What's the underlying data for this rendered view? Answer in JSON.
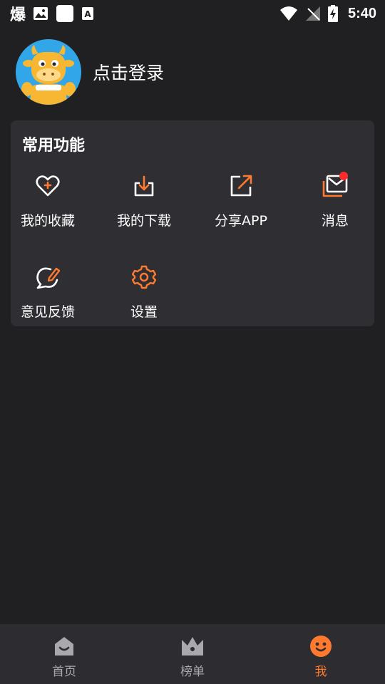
{
  "status_bar": {
    "app_text": "爆",
    "time": "5:40"
  },
  "profile": {
    "login_text": "点击登录"
  },
  "common_functions": {
    "title": "常用功能",
    "items": [
      {
        "label": "我的收藏",
        "icon": "heart-plus-icon"
      },
      {
        "label": "我的下载",
        "icon": "download-icon"
      },
      {
        "label": "分享APP",
        "icon": "share-icon"
      },
      {
        "label": "消息",
        "icon": "message-icon",
        "has_badge": true
      },
      {
        "label": "意见反馈",
        "icon": "feedback-icon"
      },
      {
        "label": "设置",
        "icon": "gear-icon"
      }
    ]
  },
  "bottom_nav": {
    "items": [
      {
        "label": "首页",
        "icon": "home-icon",
        "active": false
      },
      {
        "label": "榜单",
        "icon": "crown-icon",
        "active": false
      },
      {
        "label": "我",
        "icon": "smile-face-icon",
        "active": true
      }
    ]
  },
  "colors": {
    "background": "#202022",
    "card": "#2f2e33",
    "accent": "#ff7a2e",
    "badge": "#ff2b2b",
    "nav_inactive": "#a8a8ad"
  }
}
